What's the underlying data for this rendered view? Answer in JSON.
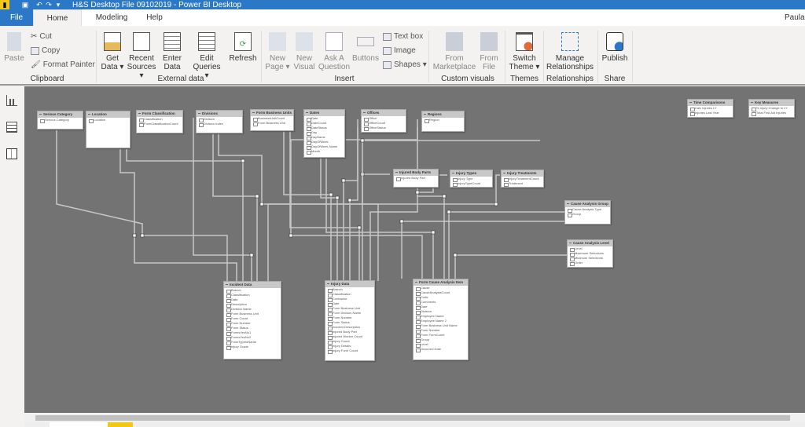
{
  "app": {
    "title": "H&S Desktop File 09102019 - Power BI Desktop",
    "user": "Paula"
  },
  "tabs": [
    {
      "label": "File"
    },
    {
      "label": "Home"
    },
    {
      "label": "Modeling"
    },
    {
      "label": "Help"
    }
  ],
  "ribbon": {
    "clipboard": {
      "paste": "Paste",
      "cut": "Cut",
      "copy": "Copy",
      "format_painter": "Format Painter",
      "group": "Clipboard"
    },
    "external": {
      "get_data": "Get Data ▾",
      "recent_sources": "Recent Sources ▾",
      "enter_data": "Enter Data",
      "edit_queries": "Edit Queries ▾",
      "refresh": "Refresh",
      "group": "External data"
    },
    "insert": {
      "new_page": "New Page ▾",
      "new_visual": "New Visual",
      "ask_question": "Ask A Question",
      "buttons": "Buttons",
      "text_box": "Text box",
      "image": "Image",
      "shapes": "Shapes ▾",
      "group": "Insert"
    },
    "custom": {
      "marketplace": "From Marketplace",
      "file": "From File",
      "group": "Custom visuals"
    },
    "themes": {
      "switch": "Switch Theme ▾",
      "group": "Themes"
    },
    "relationships": {
      "manage": "Manage Relationships",
      "group": "Relationships"
    },
    "share": {
      "publish": "Publish",
      "group": "Share"
    }
  },
  "nav": [
    {
      "icon": "report-view-icon"
    },
    {
      "icon": "data-view-icon"
    },
    {
      "icon": "model-view-icon"
    }
  ],
  "tables": [
    {
      "name": "Serious Category",
      "fields": [
        "Serious Category"
      ]
    },
    {
      "name": "Location",
      "fields": [
        "Location"
      ]
    },
    {
      "name": "Form Classification",
      "fields": [
        "Classification",
        "FormClassificationCount"
      ]
    },
    {
      "name": "Divisions",
      "fields": [
        "Division",
        "Division Index"
      ]
    },
    {
      "name": "Form Business Units",
      "fields": [
        "BusinessUnitCount",
        "Form Business Unit"
      ]
    },
    {
      "name": "Dates",
      "fields": [
        "Date",
        "DateCount",
        "DateStatus",
        "Day",
        "DayName",
        "DayOfWeek",
        "DayOfWeek Name",
        "Month"
      ]
    },
    {
      "name": "Offices",
      "fields": [
        "Office",
        "OfficeCount",
        "OfficeStatus"
      ]
    },
    {
      "name": "Regions",
      "fields": [
        "Region"
      ]
    },
    {
      "name": "Injured Body Parts",
      "fields": [
        "Injured Body Part"
      ]
    },
    {
      "name": "Injury Types",
      "fields": [
        "Injury Type",
        "InjuryTypeCount"
      ]
    },
    {
      "name": "Injury Treatments",
      "fields": [
        "InjuryTreatmentCount",
        "Treatment"
      ]
    },
    {
      "name": "Cause Analysis Group",
      "fields": [
        "Cause Analysis Type",
        "Group"
      ]
    },
    {
      "name": "Cause Analysis Level",
      "fields": [
        "Level",
        "Maximum Selections",
        "Minimum Selections",
        "Order"
      ]
    },
    {
      "name": "Time Comparisons",
      "fields": [
        "Calc Injuries LY",
        "Injuries Last Year"
      ]
    },
    {
      "name": "Key Measures",
      "fields": [
        "% Injury Change to LY",
        "Total First Aid Injuries"
      ]
    },
    {
      "name": "Incident Data",
      "fields": [
        "Branch",
        "Classification",
        "Date",
        "Description",
        "Division Name",
        "Form Business Unit",
        "Form Count",
        "Form Number",
        "Form Status",
        "FormsYesNo1",
        "FormsYesNo2",
        "FormTypeIdName",
        "Injury Grade"
      ]
    },
    {
      "name": "Injury Data",
      "fields": [
        "Branch",
        "Classification",
        "Contractor",
        "Date",
        "Form Business Unit",
        "Form Division Name",
        "Form Number",
        "Form Status",
        "Incident Description",
        "Injured Body Part",
        "Injured Worker Count",
        "Injury Count",
        "Injury Details",
        "Injury Form Count"
      ]
    },
    {
      "name": "Form Cause Analysis Item",
      "fields": [
        "Cause",
        "CauseAnalysisCount",
        "Code",
        "Comments",
        "Date",
        "Division",
        "Employee Name",
        "Employee Name 2",
        "Form Business Unit Name",
        "Form Number",
        "Form FormCount",
        "Group",
        "Level",
        "Occurred Date"
      ]
    }
  ],
  "colors": {
    "accent": "#2b78c9",
    "canvas": "#737373"
  }
}
